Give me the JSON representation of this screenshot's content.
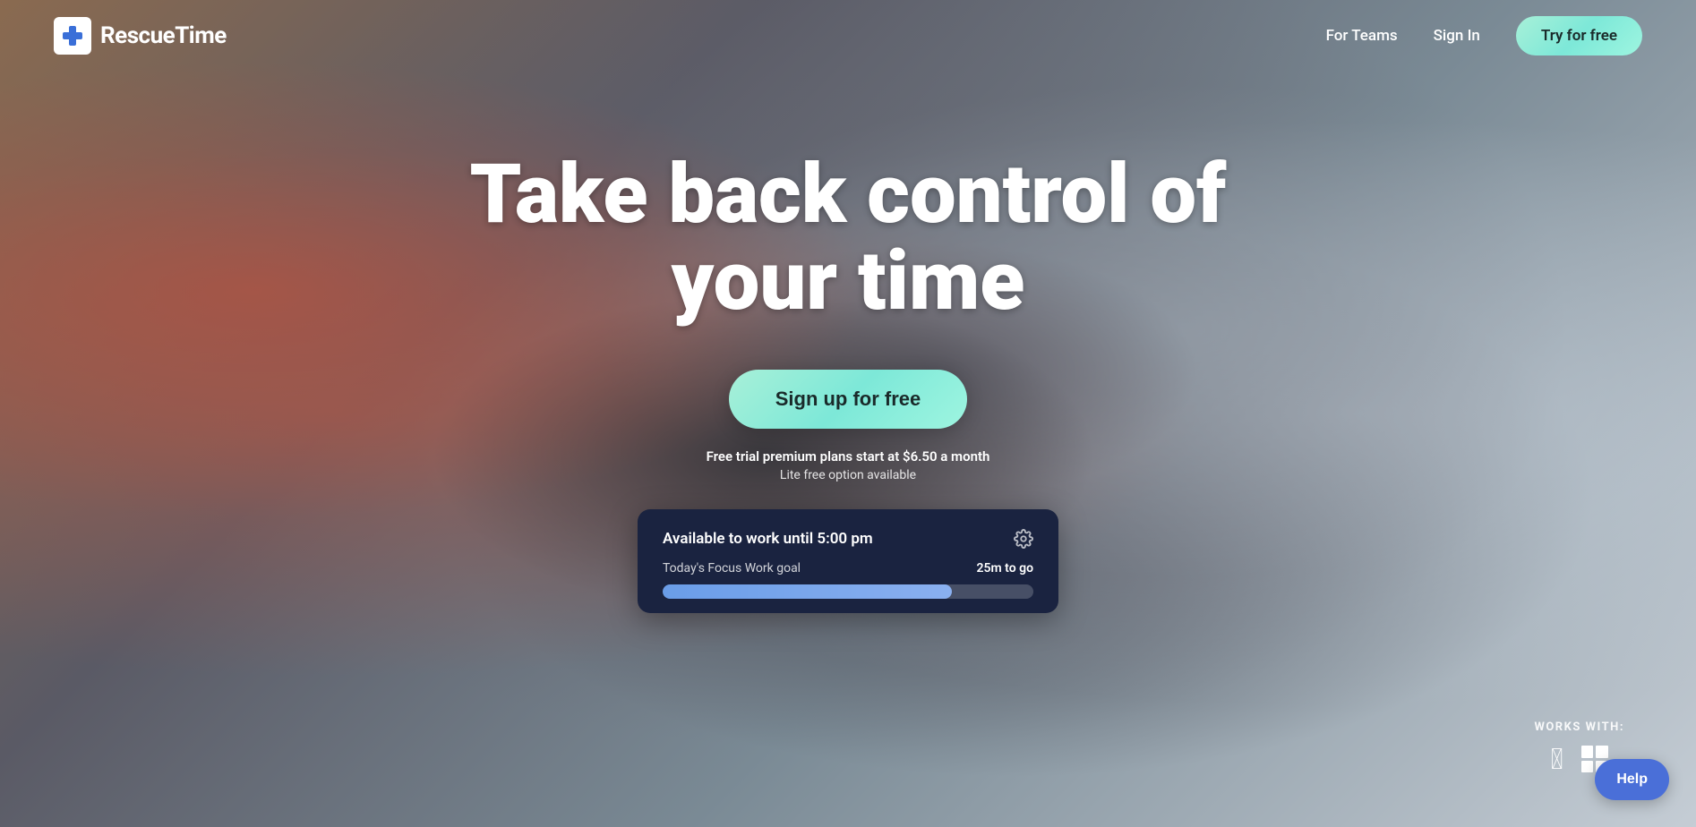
{
  "brand": {
    "name": "RescueTime",
    "logo_alt": "RescueTime logo"
  },
  "navbar": {
    "for_teams_label": "For Teams",
    "sign_in_label": "Sign In",
    "try_free_label": "Try for free"
  },
  "hero": {
    "title_line1": "Take back control of",
    "title_line2": "your time",
    "cta_label": "Sign up for free",
    "sub_line1": "Free trial premium plans start at $6.50 a month",
    "sub_line2": "Lite free option available"
  },
  "focus_card": {
    "title": "Available to work until 5:00 pm",
    "goal_label": "Today's Focus Work goal",
    "goal_value": "25m to go",
    "progress_percent": 78
  },
  "works_with": {
    "label": "WORKS WITH:"
  },
  "help_button": {
    "label": "Help"
  }
}
